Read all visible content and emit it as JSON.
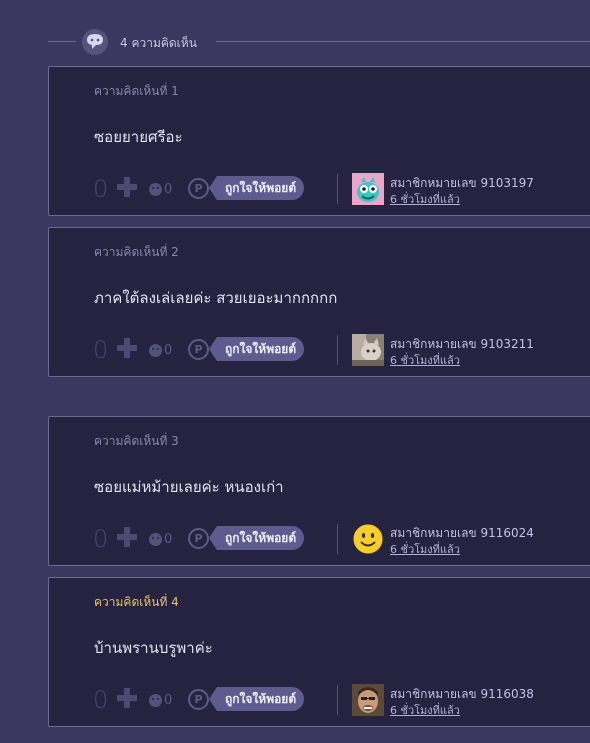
{
  "header": {
    "count_label": "4 ความคิดเห็น"
  },
  "comments": [
    {
      "number_label": "ความคิดเห็นที่ 1",
      "text": "ซอยยายศรีอะ",
      "score": "0",
      "emotion_count": "0",
      "like_label": "ถูกใจให้พอยต์",
      "username": "สมาชิกหมายเลข 9103197",
      "time": "6 ชั่วโมงที่แล้ว",
      "avatar": "monster-avatar",
      "highlight": false
    },
    {
      "number_label": "ความคิดเห็นที่ 2",
      "text": "ภาคใต้ลงเล่เลยค่ะ สวยเยอะมากกกกก",
      "score": "0",
      "emotion_count": "0",
      "like_label": "ถูกใจให้พอยต์",
      "username": "สมาชิกหมายเลข 9103211",
      "time": "6 ชั่วโมงที่แล้ว",
      "avatar": "cat-photo-avatar",
      "highlight": false
    },
    {
      "number_label": "ความคิดเห็นที่ 3",
      "text": "ซอยแม่หม้ายเลยค่ะ หนองเก่า",
      "score": "0",
      "emotion_count": "0",
      "like_label": "ถูกใจให้พอยต์",
      "username": "สมาชิกหมายเลข 9116024",
      "time": "6 ชั่วโมงที่แล้ว",
      "avatar": "smiley-avatar",
      "highlight": false
    },
    {
      "number_label": "ความคิดเห็นที่ 4",
      "text": "บ้านพรานบรูพาค่ะ",
      "score": "0",
      "emotion_count": "0",
      "like_label": "ถูกใจให้พอยต์",
      "username": "สมาชิกหมายเลข 9116038",
      "time": "6 ชั่วโมงที่แล้ว",
      "avatar": "person-photo-avatar",
      "highlight": true
    }
  ],
  "colors": {
    "background": "#3b375f",
    "card": "#25233f",
    "highlight_number": "#e6c267",
    "like_button": "#5f5b8f"
  }
}
